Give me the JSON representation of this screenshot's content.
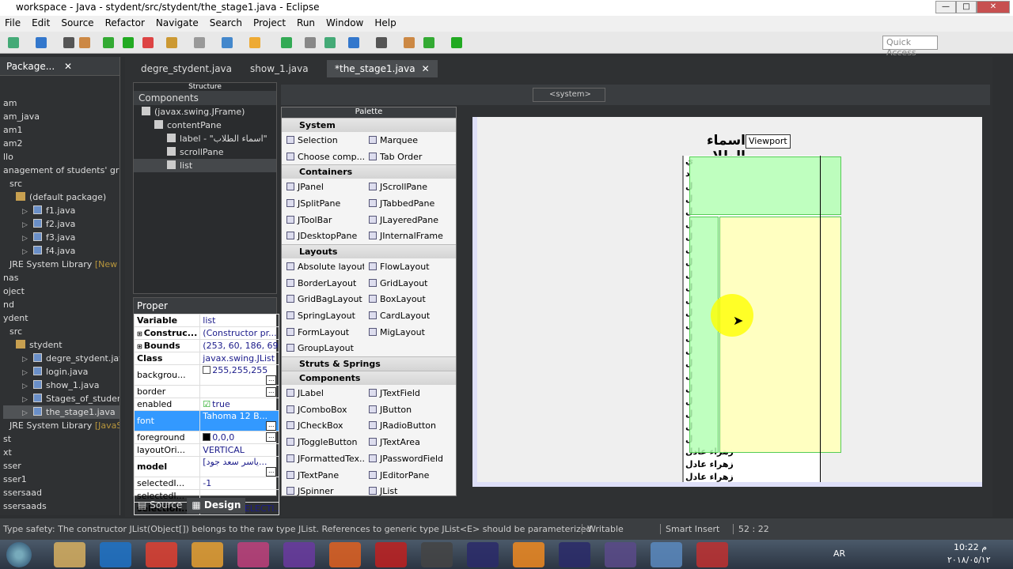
{
  "window": {
    "title": "workspace - Java - stydent/src/stydent/the_stage1.java - Eclipse",
    "min": "—",
    "max": "□",
    "close": "✕"
  },
  "menu": [
    "File",
    "Edit",
    "Source",
    "Refactor",
    "Navigate",
    "Search",
    "Project",
    "Run",
    "Window",
    "Help"
  ],
  "toolbar": {
    "quick_access": "Quick Access"
  },
  "package_explorer": {
    "title": "Package...",
    "items": [
      {
        "label": "am",
        "indent": 0
      },
      {
        "label": "am_java",
        "indent": 0
      },
      {
        "label": "am1",
        "indent": 0
      },
      {
        "label": "am2",
        "indent": 0
      },
      {
        "label": "llo",
        "indent": 0
      },
      {
        "label": "anagement of students' gra",
        "indent": 0
      },
      {
        "label": "src",
        "indent": 1
      },
      {
        "label": "(default package)",
        "indent": 2,
        "icon": "package"
      },
      {
        "label": "f1.java",
        "indent": 3,
        "icon": "java"
      },
      {
        "label": "f2.java",
        "indent": 3,
        "icon": "java"
      },
      {
        "label": "f3.java",
        "indent": 3,
        "icon": "java"
      },
      {
        "label": "f4.java",
        "indent": 3,
        "icon": "java"
      },
      {
        "label": "JRE System Library",
        "suffix": "[New f",
        "indent": 1
      },
      {
        "label": "nas",
        "indent": 0
      },
      {
        "label": "oject",
        "indent": 0
      },
      {
        "label": "nd",
        "indent": 0
      },
      {
        "label": "ydent",
        "indent": 0
      },
      {
        "label": "src",
        "indent": 1
      },
      {
        "label": "stydent",
        "indent": 2,
        "icon": "package"
      },
      {
        "label": "degre_stydent.java",
        "indent": 3,
        "icon": "java"
      },
      {
        "label": "login.java",
        "indent": 3,
        "icon": "java"
      },
      {
        "label": "show_1.java",
        "indent": 3,
        "icon": "java"
      },
      {
        "label": "Stages_of_students",
        "indent": 3,
        "icon": "java"
      },
      {
        "label": "the_stage1.java",
        "indent": 3,
        "icon": "java",
        "selected": true
      },
      {
        "label": "JRE System Library",
        "suffix": "[JavaSE",
        "indent": 1
      },
      {
        "label": "st",
        "indent": 0
      },
      {
        "label": "xt",
        "indent": 0
      },
      {
        "label": "sser",
        "indent": 0
      },
      {
        "label": "sser1",
        "indent": 0
      },
      {
        "label": "ssersaad",
        "indent": 0
      },
      {
        "label": "ssersaads",
        "indent": 0
      }
    ]
  },
  "editor_tabs": [
    "degre_stydent.java",
    "show_1.java",
    "*the_stage1.java"
  ],
  "structure": {
    "title": "Structure",
    "components_title": "Components",
    "tree": [
      "(javax.swing.JFrame)",
      "contentPane",
      "label - \"اسماء الطلاب\"",
      "scrollPane",
      "list"
    ]
  },
  "properties": {
    "title": "Proper",
    "rows": [
      {
        "k": "Variable",
        "v": "list",
        "bold": true
      },
      {
        "k": "Construc...",
        "v": "(Constructor pr...",
        "bold": true,
        "exp": true
      },
      {
        "k": "Bounds",
        "v": "(253, 60, 186, 697)",
        "bold": true,
        "exp": true
      },
      {
        "k": "Class",
        "v": "javax.swing.JList",
        "bold": true
      },
      {
        "k": "backgrou...",
        "v": "255,255,255",
        "dots": true,
        "swatch": "#ffffff"
      },
      {
        "k": "border",
        "v": "",
        "dots": true
      },
      {
        "k": "enabled",
        "v": "true",
        "check": true
      },
      {
        "k": "font",
        "v": "Tahoma 12 B...",
        "dots": true,
        "sel": true
      },
      {
        "k": "foreground",
        "v": "0,0,0",
        "dots": true,
        "swatch": "#000000"
      },
      {
        "k": "layoutOri...",
        "v": "VERTICAL"
      },
      {
        "k": "model",
        "v": "[ياسر سعد جود...",
        "bold": true,
        "dots": true
      },
      {
        "k": "selectedI...",
        "v": "-1"
      },
      {
        "k": "selectedI...",
        "v": ""
      },
      {
        "k": "selection...",
        "v": "SINGLE_SELECTI...",
        "bold": true
      }
    ]
  },
  "palette": {
    "title": "Palette",
    "sections": [
      {
        "name": "System",
        "items": [
          "Selection",
          "Marquee",
          "Choose comp...",
          "Tab Order"
        ]
      },
      {
        "name": "Containers",
        "items": [
          "JPanel",
          "JScrollPane",
          "JSplitPane",
          "JTabbedPane",
          "JToolBar",
          "JLayeredPane",
          "JDesktopPane",
          "JInternalFrame"
        ]
      },
      {
        "name": "Layouts",
        "items": [
          "Absolute layout",
          "FlowLayout",
          "BorderLayout",
          "GridLayout",
          "GridBagLayout",
          "BoxLayout",
          "SpringLayout",
          "CardLayout",
          "FormLayout",
          "MigLayout",
          "GroupLayout"
        ]
      },
      {
        "name": "Struts & Springs",
        "items": []
      },
      {
        "name": "Components",
        "items": [
          "JLabel",
          "JTextField",
          "JComboBox",
          "JButton",
          "JCheckBox",
          "JRadioButton",
          "JToggleButton",
          "JTextArea",
          "JFormattedTex...",
          "JPasswordField",
          "JTextPane",
          "JEditorPane",
          "JSpinner",
          "JList"
        ]
      }
    ]
  },
  "design_toolbar": {
    "system_select": "<system>"
  },
  "form": {
    "label": "اسماء الطلاب",
    "tooltip": "Viewport",
    "list_items": [
      "ي",
      "د",
      "ل",
      "ل",
      "ل",
      "ل",
      "ل",
      "ل",
      "ل",
      "ل",
      "ل",
      "ل",
      "ل",
      "ل",
      "ل",
      "ل",
      "ل",
      "ل",
      "ل",
      "ل",
      "ل",
      "ل",
      "ل",
      "زهراء عادل",
      "زهراء عادل",
      "زهراء عادل"
    ]
  },
  "bottom_tabs": {
    "source": "Source",
    "design": "Design"
  },
  "status": {
    "message": "Type safety: The constructor JList(Object[]) belongs to the raw type JList. References to generic type JList<E> should be parameterized",
    "writable": "Writable",
    "insert": "Smart Insert",
    "position": "52 : 22"
  },
  "taskbar": {
    "lang": "AR",
    "time": "10:22 م",
    "date": "٢٠١٨/٠٥/١٢"
  }
}
